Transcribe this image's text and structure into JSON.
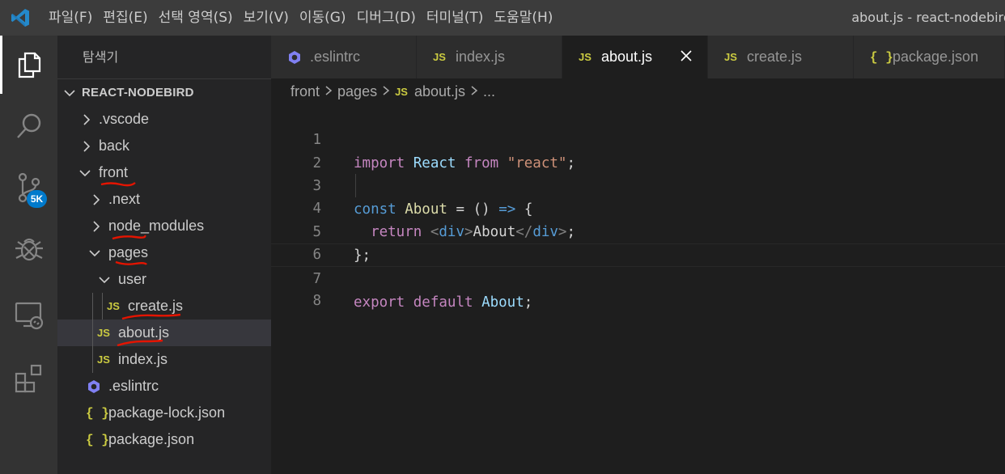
{
  "menu": [
    "파일(F)",
    "편집(E)",
    "선택 영역(S)",
    "보기(V)",
    "이동(G)",
    "디버그(D)",
    "터미널(T)",
    "도움말(H)"
  ],
  "window_title": "about.js - react-nodebird",
  "activity": {
    "badge": "5K"
  },
  "sidebar": {
    "title": "탐색기",
    "section": "REACT-NODEBIRD",
    "items": [
      {
        "label": ".vscode"
      },
      {
        "label": "back"
      },
      {
        "label": "front"
      },
      {
        "label": ".next"
      },
      {
        "label": "node_modules"
      },
      {
        "label": "pages"
      },
      {
        "label": "user"
      },
      {
        "label": "create.js",
        "badge": "JS"
      },
      {
        "label": "about.js",
        "badge": "JS"
      },
      {
        "label": "index.js",
        "badge": "JS"
      },
      {
        "label": ".eslintrc"
      },
      {
        "label": "package-lock.json",
        "badge": "{ }"
      },
      {
        "label": "package.json",
        "badge": "{ }"
      }
    ]
  },
  "tabs": [
    {
      "label": ".eslintrc"
    },
    {
      "label": "index.js",
      "badge": "JS"
    },
    {
      "label": "about.js",
      "badge": "JS",
      "active": true
    },
    {
      "label": "create.js",
      "badge": "JS"
    },
    {
      "label": "package.json",
      "badge": "{ }"
    }
  ],
  "breadcrumb": [
    "front",
    "pages",
    "about.js",
    "..."
  ],
  "breadcrumb_badge": "JS",
  "code": {
    "line_numbers": [
      "1",
      "2",
      "3",
      "4",
      "5",
      "6",
      "7",
      "8"
    ],
    "l1": {
      "a": "import",
      "b": "React",
      "c": "from",
      "d": "\"react\"",
      "e": ";"
    },
    "l3": {
      "a": "const",
      "b": "About",
      "c": "=",
      "d": "()",
      "e": "=>",
      "f": "{"
    },
    "l4": {
      "a": "return",
      "b": "<",
      "c": "div",
      "d": ">",
      "e": "About",
      "f": "</",
      "g": "div",
      "h": ">",
      "i": ";"
    },
    "l5": {
      "a": "};"
    },
    "l7": {
      "a": "export",
      "b": "default",
      "c": "About",
      "d": ";"
    }
  },
  "colors": {
    "accent": "#007acc",
    "js_badge": "#cbcb41",
    "annotation": "#e51400"
  }
}
